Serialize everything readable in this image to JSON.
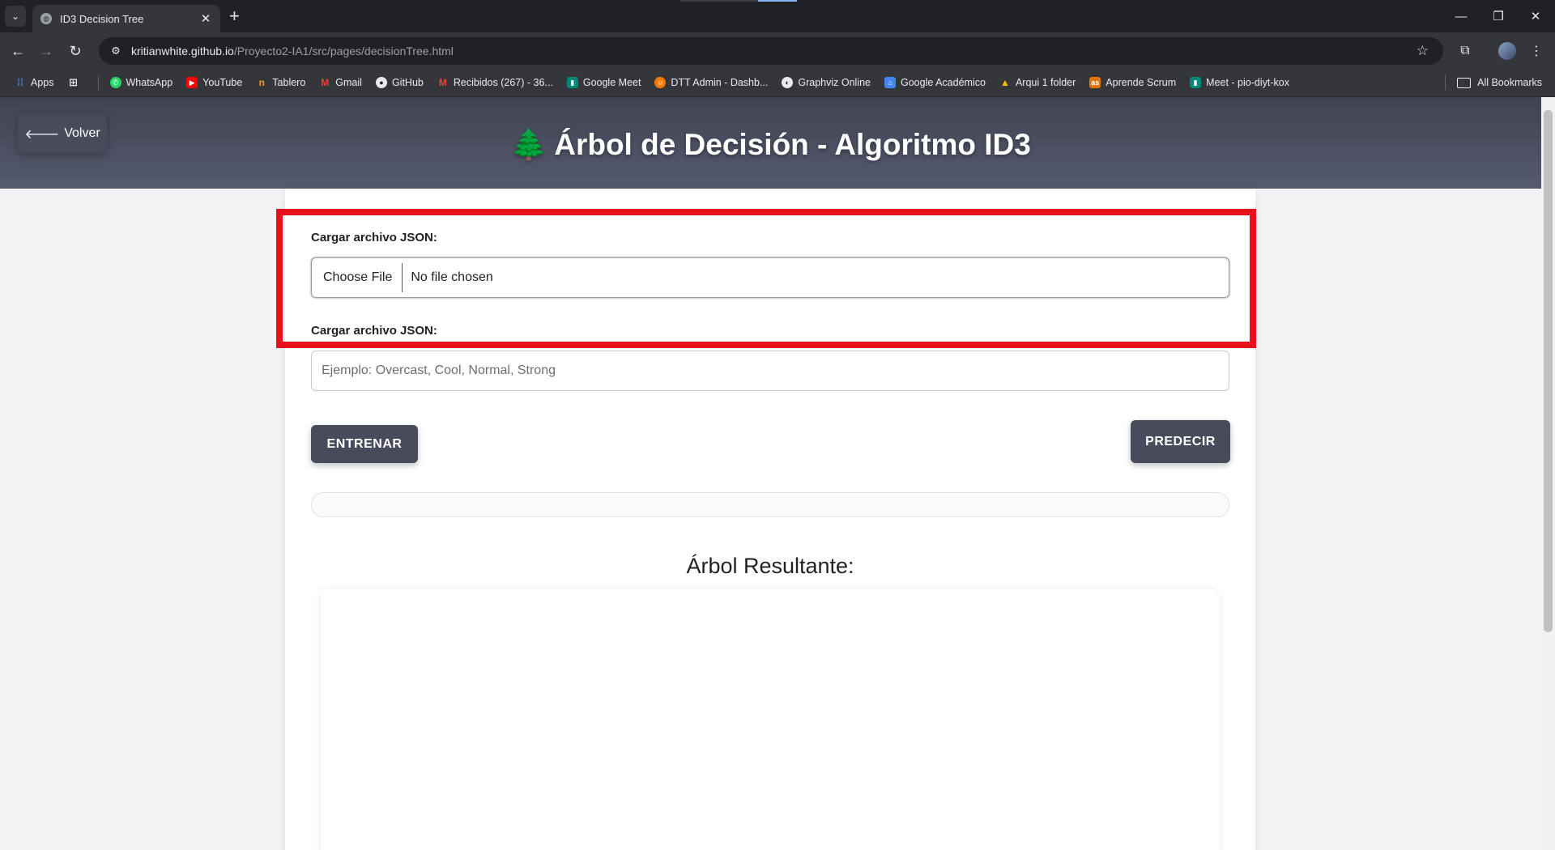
{
  "browser": {
    "tab_title": "ID3 Decision Tree",
    "tab_close": "✕",
    "new_tab": "+",
    "url_host": "kritianwhite.github.io",
    "url_path": "/Proyecto2-IA1/src/pages/decisionTree.html",
    "window_controls": {
      "minimize": "—",
      "restore": "❐",
      "close": "✕"
    },
    "bookmarks": [
      {
        "label": "Apps",
        "icon": "apps-grid-icon",
        "color": "#4285f4"
      },
      {
        "label": "WhatsApp",
        "icon": "whatsapp-icon",
        "color": "#25d366"
      },
      {
        "label": "YouTube",
        "icon": "youtube-icon",
        "color": "#ff0000"
      },
      {
        "label": "Tablero",
        "icon": "tablero-icon",
        "color": "#f4a200"
      },
      {
        "label": "Gmail",
        "icon": "gmail-icon",
        "color": "#ea4335"
      },
      {
        "label": "GitHub",
        "icon": "github-icon",
        "color": "#e8eaed"
      },
      {
        "label": "Recibidos (267) - 36...",
        "icon": "gmail-icon",
        "color": "#ea4335"
      },
      {
        "label": "Google Meet",
        "icon": "google-meet-icon",
        "color": "#00897b"
      },
      {
        "label": "DTT Admin - Dashb...",
        "icon": "dtt-admin-icon",
        "color": "#f57c00"
      },
      {
        "label": "Graphviz Online",
        "icon": "graphviz-icon",
        "color": "#e8eaed"
      },
      {
        "label": "Google Académico",
        "icon": "google-scholar-icon",
        "color": "#4285f4"
      },
      {
        "label": "Arqui 1 folder",
        "icon": "google-drive-icon",
        "color": "#fbbc04"
      },
      {
        "label": "Aprende Scrum",
        "icon": "aprende-scrum-icon",
        "color": "#e37400"
      },
      {
        "label": "Meet - pio-diyt-kox",
        "icon": "google-meet-icon",
        "color": "#00897b"
      }
    ],
    "all_bookmarks": "All Bookmarks"
  },
  "header": {
    "back_label": "Volver",
    "title_icon": "🌲",
    "title": "Árbol de Decisión - Algoritmo ID3"
  },
  "form": {
    "file_label": "Cargar archivo JSON:",
    "file_button": "Choose File",
    "file_status": "No file chosen",
    "second_label": "Cargar archivo JSON:",
    "predict_placeholder": "Ejemplo: Overcast, Cool, Normal, Strong",
    "train_button": "ENTRENAR",
    "predict_button": "PREDECIR"
  },
  "result": {
    "title": "Árbol Resultante:"
  },
  "colors": {
    "header_bg": "#474b5c",
    "button_bg": "#474b5c",
    "highlight": "#e8101b"
  }
}
